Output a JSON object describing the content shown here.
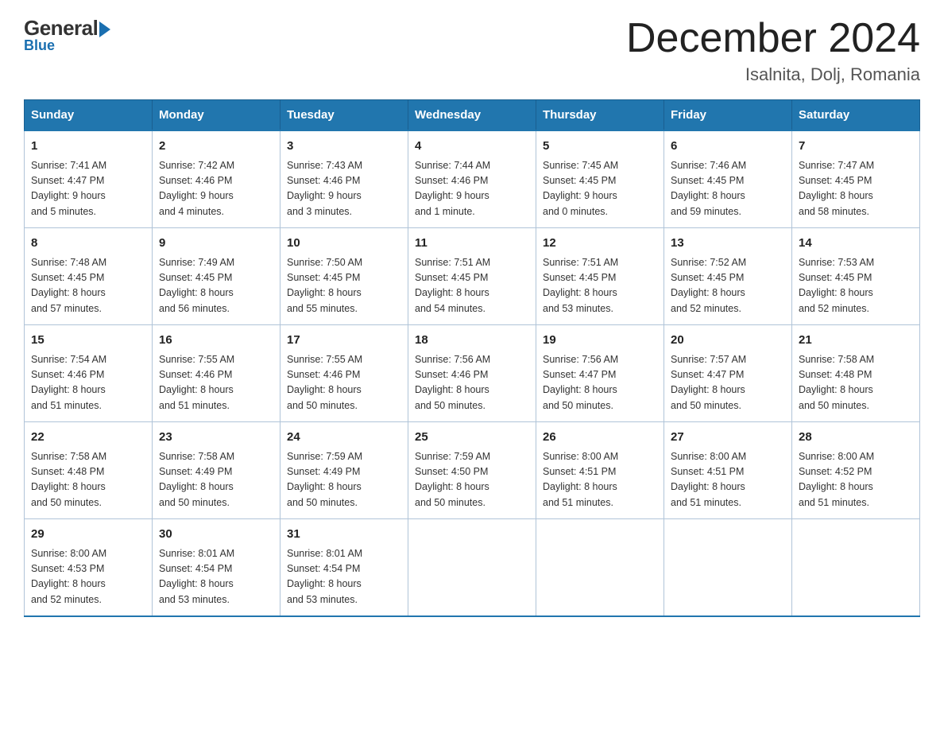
{
  "logo": {
    "general": "General",
    "blue": "Blue"
  },
  "title": "December 2024",
  "location": "Isalnita, Dolj, Romania",
  "weekdays": [
    "Sunday",
    "Monday",
    "Tuesday",
    "Wednesday",
    "Thursday",
    "Friday",
    "Saturday"
  ],
  "weeks": [
    [
      {
        "day": "1",
        "sunrise": "7:41 AM",
        "sunset": "4:47 PM",
        "daylight": "9 hours and 5 minutes."
      },
      {
        "day": "2",
        "sunrise": "7:42 AM",
        "sunset": "4:46 PM",
        "daylight": "9 hours and 4 minutes."
      },
      {
        "day": "3",
        "sunrise": "7:43 AM",
        "sunset": "4:46 PM",
        "daylight": "9 hours and 3 minutes."
      },
      {
        "day": "4",
        "sunrise": "7:44 AM",
        "sunset": "4:46 PM",
        "daylight": "9 hours and 1 minute."
      },
      {
        "day": "5",
        "sunrise": "7:45 AM",
        "sunset": "4:45 PM",
        "daylight": "9 hours and 0 minutes."
      },
      {
        "day": "6",
        "sunrise": "7:46 AM",
        "sunset": "4:45 PM",
        "daylight": "8 hours and 59 minutes."
      },
      {
        "day": "7",
        "sunrise": "7:47 AM",
        "sunset": "4:45 PM",
        "daylight": "8 hours and 58 minutes."
      }
    ],
    [
      {
        "day": "8",
        "sunrise": "7:48 AM",
        "sunset": "4:45 PM",
        "daylight": "8 hours and 57 minutes."
      },
      {
        "day": "9",
        "sunrise": "7:49 AM",
        "sunset": "4:45 PM",
        "daylight": "8 hours and 56 minutes."
      },
      {
        "day": "10",
        "sunrise": "7:50 AM",
        "sunset": "4:45 PM",
        "daylight": "8 hours and 55 minutes."
      },
      {
        "day": "11",
        "sunrise": "7:51 AM",
        "sunset": "4:45 PM",
        "daylight": "8 hours and 54 minutes."
      },
      {
        "day": "12",
        "sunrise": "7:51 AM",
        "sunset": "4:45 PM",
        "daylight": "8 hours and 53 minutes."
      },
      {
        "day": "13",
        "sunrise": "7:52 AM",
        "sunset": "4:45 PM",
        "daylight": "8 hours and 52 minutes."
      },
      {
        "day": "14",
        "sunrise": "7:53 AM",
        "sunset": "4:45 PM",
        "daylight": "8 hours and 52 minutes."
      }
    ],
    [
      {
        "day": "15",
        "sunrise": "7:54 AM",
        "sunset": "4:46 PM",
        "daylight": "8 hours and 51 minutes."
      },
      {
        "day": "16",
        "sunrise": "7:55 AM",
        "sunset": "4:46 PM",
        "daylight": "8 hours and 51 minutes."
      },
      {
        "day": "17",
        "sunrise": "7:55 AM",
        "sunset": "4:46 PM",
        "daylight": "8 hours and 50 minutes."
      },
      {
        "day": "18",
        "sunrise": "7:56 AM",
        "sunset": "4:46 PM",
        "daylight": "8 hours and 50 minutes."
      },
      {
        "day": "19",
        "sunrise": "7:56 AM",
        "sunset": "4:47 PM",
        "daylight": "8 hours and 50 minutes."
      },
      {
        "day": "20",
        "sunrise": "7:57 AM",
        "sunset": "4:47 PM",
        "daylight": "8 hours and 50 minutes."
      },
      {
        "day": "21",
        "sunrise": "7:58 AM",
        "sunset": "4:48 PM",
        "daylight": "8 hours and 50 minutes."
      }
    ],
    [
      {
        "day": "22",
        "sunrise": "7:58 AM",
        "sunset": "4:48 PM",
        "daylight": "8 hours and 50 minutes."
      },
      {
        "day": "23",
        "sunrise": "7:58 AM",
        "sunset": "4:49 PM",
        "daylight": "8 hours and 50 minutes."
      },
      {
        "day": "24",
        "sunrise": "7:59 AM",
        "sunset": "4:49 PM",
        "daylight": "8 hours and 50 minutes."
      },
      {
        "day": "25",
        "sunrise": "7:59 AM",
        "sunset": "4:50 PM",
        "daylight": "8 hours and 50 minutes."
      },
      {
        "day": "26",
        "sunrise": "8:00 AM",
        "sunset": "4:51 PM",
        "daylight": "8 hours and 51 minutes."
      },
      {
        "day": "27",
        "sunrise": "8:00 AM",
        "sunset": "4:51 PM",
        "daylight": "8 hours and 51 minutes."
      },
      {
        "day": "28",
        "sunrise": "8:00 AM",
        "sunset": "4:52 PM",
        "daylight": "8 hours and 51 minutes."
      }
    ],
    [
      {
        "day": "29",
        "sunrise": "8:00 AM",
        "sunset": "4:53 PM",
        "daylight": "8 hours and 52 minutes."
      },
      {
        "day": "30",
        "sunrise": "8:01 AM",
        "sunset": "4:54 PM",
        "daylight": "8 hours and 53 minutes."
      },
      {
        "day": "31",
        "sunrise": "8:01 AM",
        "sunset": "4:54 PM",
        "daylight": "8 hours and 53 minutes."
      },
      null,
      null,
      null,
      null
    ]
  ],
  "labels": {
    "sunrise": "Sunrise:",
    "sunset": "Sunset:",
    "daylight": "Daylight:"
  }
}
